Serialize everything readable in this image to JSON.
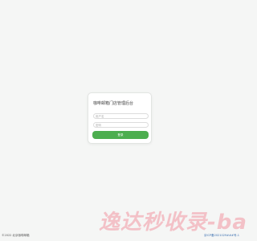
{
  "login": {
    "title": "咖啡邮箱门店管理后台",
    "username_placeholder": "用户名",
    "password_placeholder": "密码",
    "submit_label": "登录"
  },
  "footer": {
    "copyright": "©2022 北京咖啡邮箱",
    "icp": "京ICP备2021029###号-1"
  },
  "watermark": {
    "text": "逸达秒收录-ba"
  },
  "colors": {
    "background": "#f5f6f5",
    "button": "#4cae4f",
    "link": "#3b6fb0"
  }
}
